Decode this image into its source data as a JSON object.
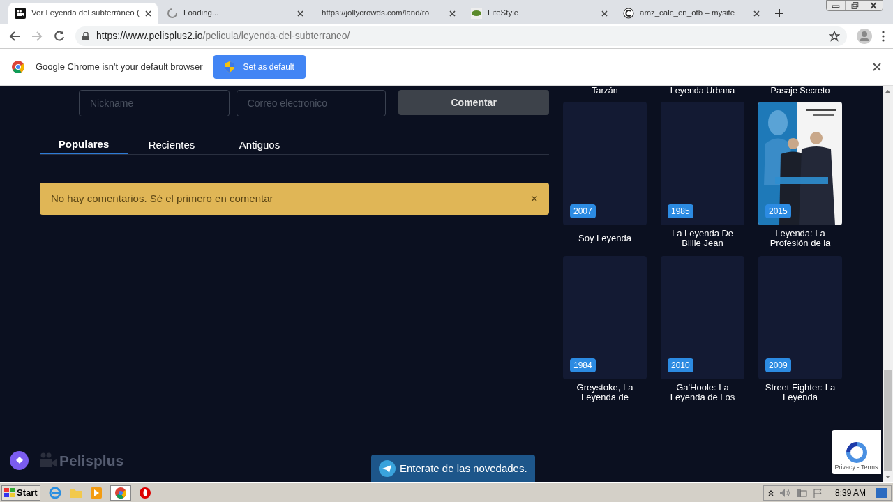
{
  "browser": {
    "tabs": [
      {
        "title": "Ver Leyenda del subterráneo (",
        "kind": "film",
        "selected": true
      },
      {
        "title": "Loading...",
        "kind": "loading",
        "selected": false
      },
      {
        "title": "https://jollycrowds.com/land/ro",
        "kind": "none",
        "selected": false
      },
      {
        "title": "LifeStyle",
        "kind": "leaf",
        "selected": false
      },
      {
        "title": "amz_calc_en_otb – mysite",
        "kind": "letter",
        "selected": false
      }
    ],
    "url_host": "https://www.pelisplus2.io",
    "url_path": "/pelicula/leyenda-del-subterraneo/"
  },
  "infobar": {
    "message": "Google Chrome isn't your default browser",
    "button": "Set as default"
  },
  "comment_form": {
    "nickname_placeholder": "Nickname",
    "email_placeholder": "Correo electronico",
    "submit": "Comentar"
  },
  "sort_tabs": [
    {
      "label": "Populares",
      "selected": true
    },
    {
      "label": "Recientes",
      "selected": false
    },
    {
      "label": "Antiguos",
      "selected": false
    }
  ],
  "alert": {
    "message": "No hay comentarios. Sé el primero en comentar",
    "close": "×"
  },
  "related": {
    "cut_titles": [
      "Tarzán",
      "Leyenda Urbana",
      "Pasaje Secreto"
    ],
    "movies": [
      {
        "year": "2007",
        "title": "Soy Leyenda",
        "kind": "placeholder"
      },
      {
        "year": "1985",
        "title": "La Leyenda De Billie Jean",
        "kind": "placeholder"
      },
      {
        "year": "2015",
        "title": "Leyenda: La Profesión de la",
        "kind": "picture"
      },
      {
        "year": "1984",
        "title": "Greystoke, La Leyenda de",
        "kind": "placeholder"
      },
      {
        "year": "2010",
        "title": "Ga'Hoole: La Leyenda de Los",
        "kind": "placeholder"
      },
      {
        "year": "2009",
        "title": "Street Fighter: La Leyenda",
        "kind": "placeholder"
      }
    ]
  },
  "footer": {
    "logo": "Pelisplus",
    "telegram": "Enterate de las novedades.",
    "recaptcha": "Privacy - Terms"
  },
  "taskbar": {
    "start": "Start",
    "clock": "8:39 AM"
  }
}
